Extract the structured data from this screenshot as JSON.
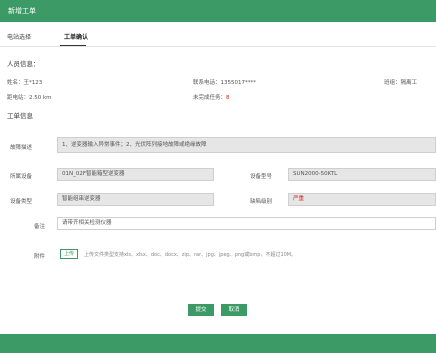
{
  "window": {
    "title": "新增工单"
  },
  "tabs": [
    {
      "label": "电站选择"
    },
    {
      "label": "工单确认"
    }
  ],
  "personnel": {
    "section_title": "人员信息：",
    "name": "姓名：王*123",
    "phone": "联系电话：1355017****",
    "group_prefix": "班组：",
    "group_value": "隔离工",
    "distance": "距电站：2.50 km",
    "unfinished_label": "未完成任务：",
    "unfinished_value": "8"
  },
  "workorder": {
    "section_title": "工单信息",
    "description_label": "故障描述",
    "description_value": "1、逆变器输入异常事件；2、光伏阵列接地故障或绝缘故障",
    "device_label": "所属设备",
    "device_value": "01N_02F智能箱型逆变器",
    "model_label": "设备型号",
    "model_value": "SUN2000-50KTL",
    "type_label": "设备类型",
    "type_value": "智能组串逆变器",
    "level_label": "缺陷级别",
    "level_value": "严重",
    "remark_label": "备注",
    "remark_value": "请带齐相关检测仪器",
    "attach_label": "附件",
    "upload_label": "上传",
    "upload_hint": "上传文件类型支持xls、xlsx、doc、docx、zip、rar、jpg、jpeg、png或bmp，不超过10M。"
  },
  "actions": {
    "confirm_label": "提交",
    "cancel_label": "取消"
  },
  "colors": {
    "accent": "#3c9a66",
    "danger": "#d52020"
  }
}
